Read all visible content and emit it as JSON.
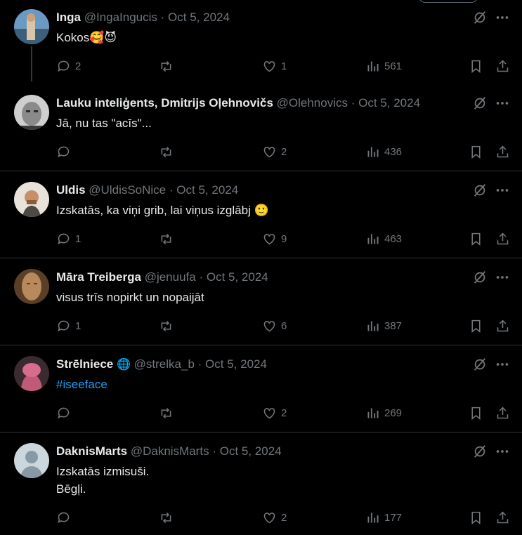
{
  "tweets": [
    {
      "name": "Inga",
      "handle": "@IngaIngucis",
      "date": "Oct 5, 2024",
      "text": "Kokos🥰😈",
      "replies": "2",
      "retweets": "",
      "likes": "1",
      "views": "561"
    },
    {
      "name": "Lauku inteliģents, Dmitrijs Oļehnovičs",
      "handle": "@Olehnovics",
      "date": "Oct 5, 2024",
      "text": "Jā, nu tas \"acīs\"...",
      "replies": "",
      "retweets": "",
      "likes": "2",
      "views": "436"
    },
    {
      "name": "Uldis",
      "handle": "@UldisSoNice",
      "date": "Oct 5, 2024",
      "text": "Izskatās, ka viņi grib, lai viņus izglābj 🙂",
      "replies": "1",
      "retweets": "",
      "likes": "9",
      "views": "463"
    },
    {
      "name": "Māra Treiberga",
      "handle": "@jenuufa",
      "date": "Oct 5, 2024",
      "text": "visus trīs nopirkt un nopaijāt",
      "replies": "1",
      "retweets": "",
      "likes": "6",
      "views": "387"
    },
    {
      "name": "Strēlniece",
      "badge": "🌐",
      "handle": "@strelka_b",
      "date": "Oct 5, 2024",
      "text": "#iseeface",
      "replies": "",
      "retweets": "",
      "likes": "2",
      "views": "269"
    },
    {
      "name": "DaknisMarts",
      "handle": "@DaknisMarts",
      "date": "Oct 5, 2024",
      "text": "Izskatās izmisuši.",
      "text2": "Bēgļi.",
      "replies": "",
      "retweets": "",
      "likes": "2",
      "views": "177"
    }
  ],
  "separator": "·",
  "colors": {
    "background": "#000000",
    "text": "#e7e9ea",
    "secondary": "#71767b",
    "divider": "#2f3336",
    "link": "#1d9bf0"
  }
}
